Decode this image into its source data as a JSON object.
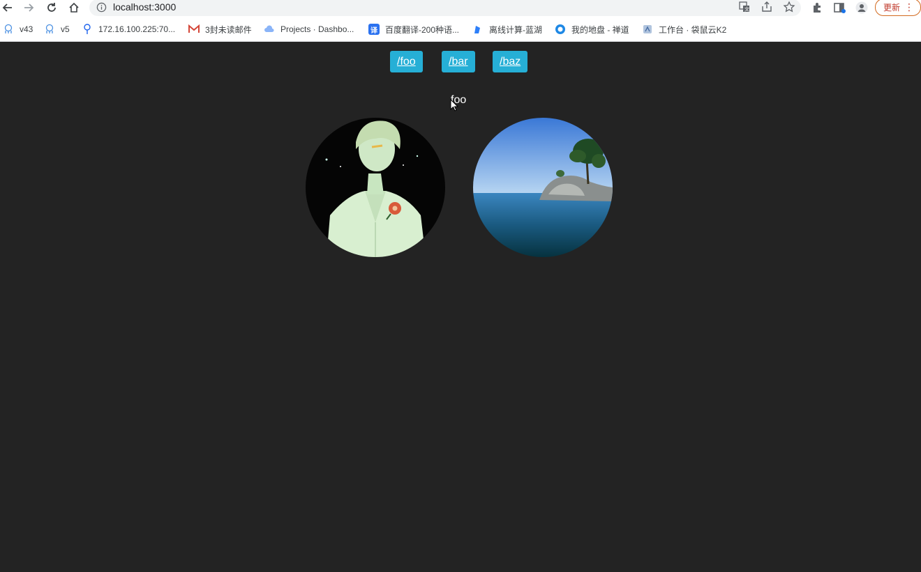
{
  "browser": {
    "url": "localhost:3000",
    "update_label": "更新",
    "update_color": "#c0392b"
  },
  "bookmarks": [
    {
      "label": "v43",
      "icon": "robot-icon"
    },
    {
      "label": "v5",
      "icon": "robot-icon"
    },
    {
      "label": "172.16.100.225:70...",
      "icon": "docker-icon"
    },
    {
      "label": "3封未读邮件",
      "icon": "gmail-icon"
    },
    {
      "label": "Projects · Dashbo...",
      "icon": "cloud-icon"
    },
    {
      "label": "百度翻译-200种语...",
      "icon": "translate-icon"
    },
    {
      "label": "离线计算-蓝湖",
      "icon": "lanhu-icon"
    },
    {
      "label": "我的地盘 - 禅道",
      "icon": "zentao-icon"
    },
    {
      "label": "工作台 · 袋鼠云K2",
      "icon": "kangaroo-icon"
    }
  ],
  "nav": {
    "links": [
      {
        "label": "/foo"
      },
      {
        "label": "/bar"
      },
      {
        "label": "/baz"
      }
    ],
    "accent": "#26afd6"
  },
  "main": {
    "route_title": "foo",
    "images": [
      {
        "name": "portrait-avatar",
        "description_icon": "illustrated-boy-image"
      },
      {
        "name": "island-avatar",
        "description_icon": "island-landscape-image"
      }
    ]
  },
  "colors": {
    "page_background": "#232323"
  }
}
